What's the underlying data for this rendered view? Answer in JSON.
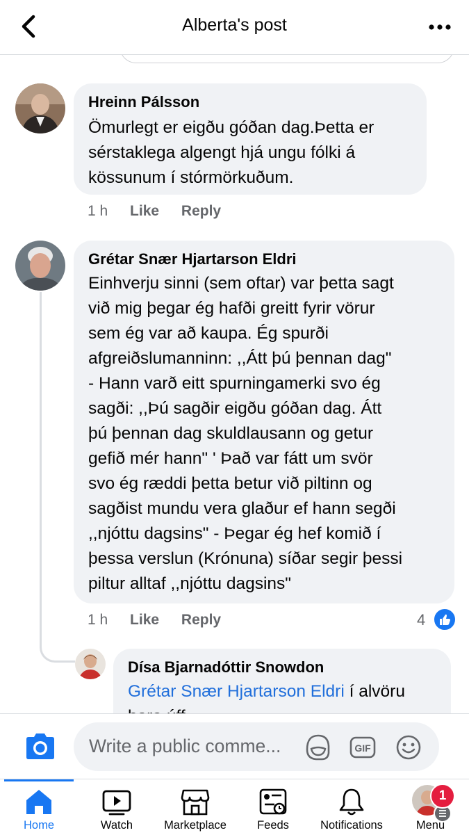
{
  "header": {
    "title": "Alberta's post"
  },
  "comments": [
    {
      "author": "Hreinn Pálsson",
      "lines": [
        "Ömurlegt er eigðu góðan dag.Þetta er",
        "sérstaklega algengt hjá ungu fólki á",
        "kössunum í stórmörkuðum."
      ],
      "time": "1 h",
      "like": "Like",
      "reply": "Reply"
    },
    {
      "author": "Grétar Snær Hjartarson Eldri",
      "lines": [
        "Einhverju sinni (sem oftar) var þetta sagt",
        "við mig þegar ég hafði greitt fyrir vörur",
        "sem ég var að kaupa.  Ég spurði",
        "afgreiðslumanninn: ,,Átt þú þennan dag\"",
        "-  Hann varð eitt spurningamerki svo ég",
        "sagði: ,,Þú sagðir eigðu góðan dag. Átt",
        "þú þennan dag  skuldlausann og getur",
        "gefið mér hann\" '  Það var fátt um svör",
        "svo ég ræddi þetta betur við piltinn og",
        "sagðist mundu vera glaður ef hann segði",
        ",,njóttu dagsins\" - Þegar ég hef komið í",
        "þessa verslun (Krónuna) síðar segir þessi",
        "piltur alltaf ,,njóttu dagsins\""
      ],
      "time": "1 h",
      "like": "Like",
      "reply": "Reply",
      "reactions": "4"
    },
    {
      "author": "Dísa Bjarnadóttir Snowdon",
      "mention": "Grétar Snær Hjartarson Eldri",
      "text_after_mention": " í alvöru",
      "line2": "bara úff"
    }
  ],
  "composer": {
    "placeholder": "Write a public comme..."
  },
  "nav": {
    "tabs": [
      {
        "label": "Home",
        "icon": "home-icon",
        "active": true
      },
      {
        "label": "Watch",
        "icon": "watch-icon"
      },
      {
        "label": "Marketplace",
        "icon": "marketplace-icon"
      },
      {
        "label": "Feeds",
        "icon": "feeds-icon"
      },
      {
        "label": "Notifications",
        "icon": "bell-icon"
      },
      {
        "label": "Menu",
        "icon": "menu-icon"
      }
    ],
    "menu_badge": "1"
  },
  "colors": {
    "accent": "#1877f2",
    "bubble": "#f0f2f5",
    "muted": "#65676b",
    "mention": "#216fdb",
    "badge": "#e41e3f"
  }
}
